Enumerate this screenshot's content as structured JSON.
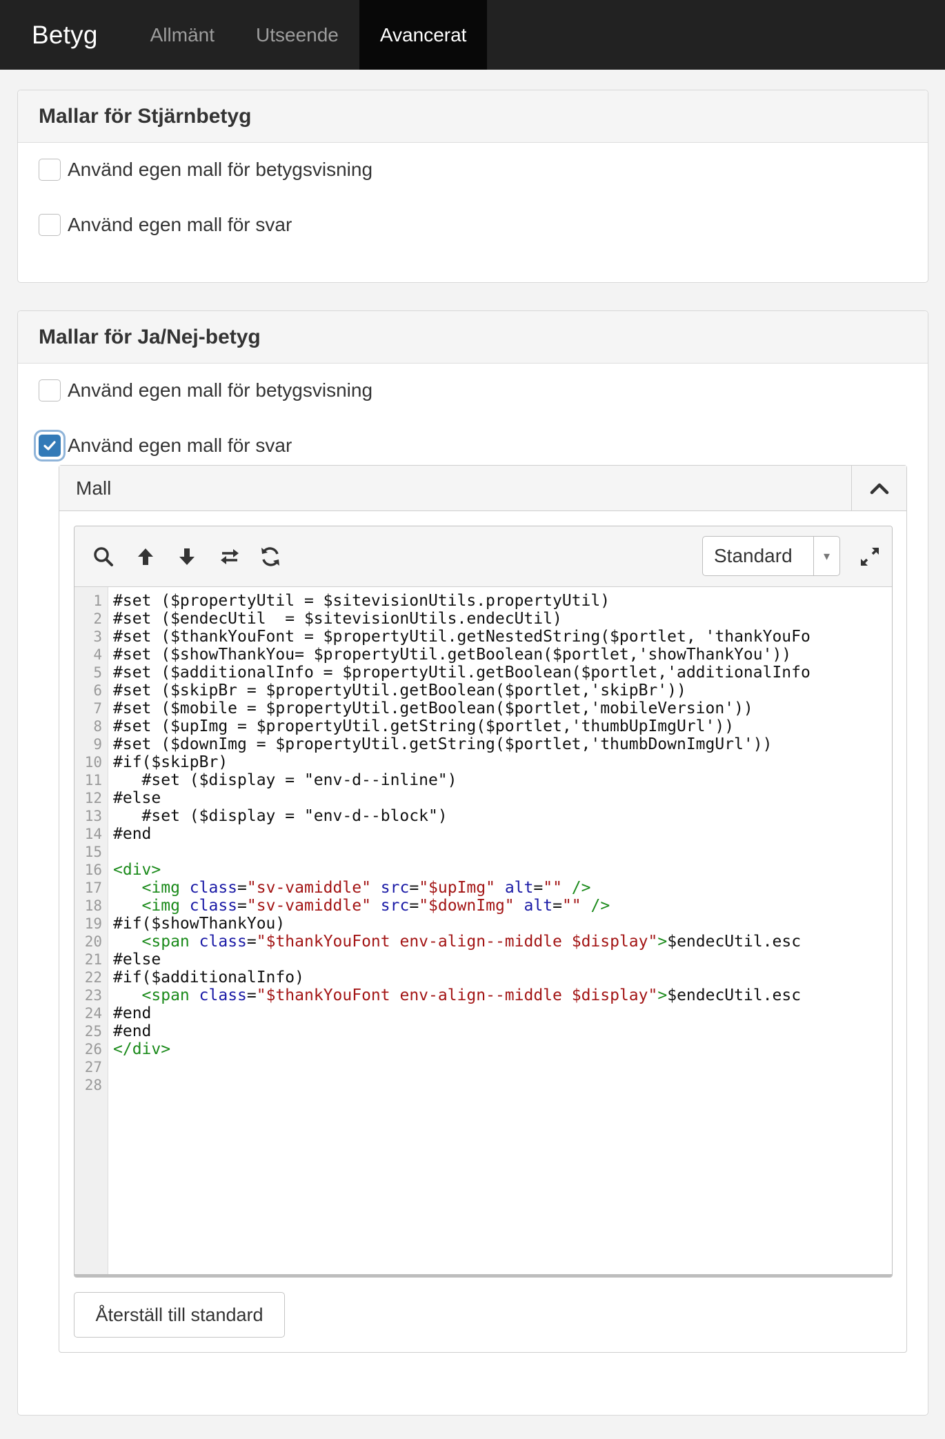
{
  "nav": {
    "brand": "Betyg",
    "tabs": [
      {
        "label": "Allmänt"
      },
      {
        "label": "Utseende"
      },
      {
        "label": "Avancerat"
      }
    ]
  },
  "panel_stars": {
    "title": "Mallar för Stjärnbetyg",
    "options": [
      {
        "label": "Använd egen mall för betygsvisning",
        "checked": false
      },
      {
        "label": "Använd egen mall för svar",
        "checked": false
      }
    ]
  },
  "panel_yesno": {
    "title": "Mallar för Ja/Nej-betyg",
    "options": [
      {
        "label": "Använd egen mall för betygsvisning",
        "checked": false
      },
      {
        "label": "Använd egen mall för svar",
        "checked": true
      }
    ],
    "template": {
      "title": "Mall",
      "mode_select": "Standard",
      "line_numbers": [
        "1",
        "2",
        "3",
        "4",
        "5",
        "6",
        "7",
        "8",
        "9",
        "10",
        "11",
        "12",
        "13",
        "14",
        "15",
        "16",
        "17",
        "18",
        "19",
        "20",
        "21",
        "22",
        "23",
        "24",
        "25",
        "26",
        "27",
        "28"
      ],
      "code_lines": [
        "#set ($propertyUtil = $sitevisionUtils.propertyUtil)",
        "#set ($endecUtil  = $sitevisionUtils.endecUtil)",
        "#set ($thankYouFont = $propertyUtil.getNestedString($portlet, 'thankYouFo",
        "#set ($showThankYou= $propertyUtil.getBoolean($portlet,'showThankYou'))",
        "#set ($additionalInfo = $propertyUtil.getBoolean($portlet,'additionalInfo",
        "#set ($skipBr = $propertyUtil.getBoolean($portlet,'skipBr'))",
        "#set ($mobile = $propertyUtil.getBoolean($portlet,'mobileVersion'))",
        "#set ($upImg = $propertyUtil.getString($portlet,'thumbUpImgUrl'))",
        "#set ($downImg = $propertyUtil.getString($portlet,'thumbDownImgUrl'))",
        "#if($skipBr)",
        "   #set ($display = \"env-d--inline\")",
        "#else",
        "   #set ($display = \"env-d--block\")",
        "#end",
        "",
        "<div>",
        "   <img class=\"sv-vamiddle\" src=\"$upImg\" alt=\"\" />",
        "   <img class=\"sv-vamiddle\" src=\"$downImg\" alt=\"\" />",
        "#if($showThankYou)",
        "   <span class=\"$thankYouFont env-align--middle $display\">$endecUtil.esc",
        "#else",
        "#if($additionalInfo)",
        "   <span class=\"$thankYouFont env-align--middle $display\">$endecUtil.esc",
        "#end",
        "#end",
        "</div>",
        "",
        ""
      ],
      "reset_button": "Återställ till standard"
    }
  },
  "colors": {
    "nav_bg": "#222222",
    "nav_active_bg": "#080808",
    "checkbox_checked": "#337ab7",
    "html_tag": "#1a8a1a",
    "html_attr": "#1a1aa6",
    "html_string": "#a31515"
  },
  "icons": [
    "search-icon",
    "arrow-up-icon",
    "arrow-down-icon",
    "swap-icon",
    "refresh-icon",
    "caret-down-icon",
    "expand-icon",
    "chevron-up-icon",
    "check-icon"
  ]
}
